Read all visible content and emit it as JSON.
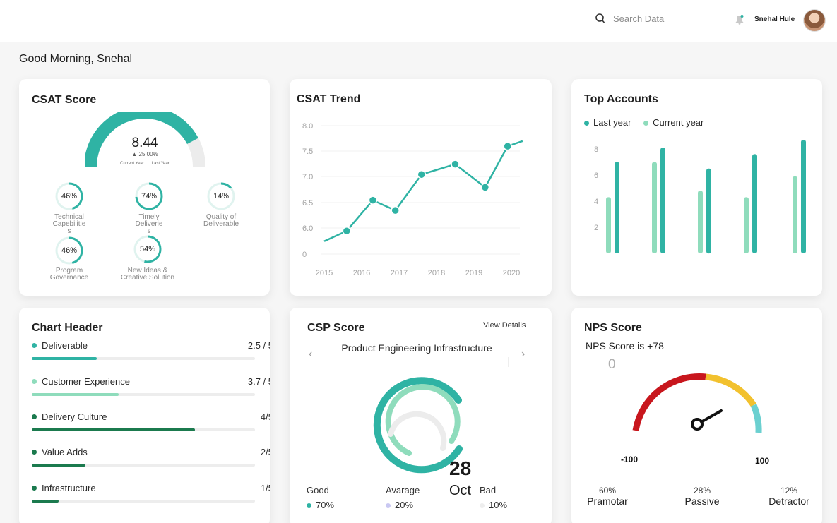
{
  "header": {
    "search_placeholder": "Search Data",
    "user_name": "Snehal Hule",
    "icons": {
      "search": "search-icon",
      "bell": "bell-icon",
      "avatar": "user-avatar"
    }
  },
  "greeting": "Good Morning, Snehal",
  "colors": {
    "teal": "#2fb3a4",
    "light_teal": "#8fdcbc",
    "dark_green": "#1b7a4e",
    "red": "#c8161d",
    "yellow": "#f2c12e",
    "cyan": "#6bd0d0"
  },
  "csat_score": {
    "title": "CSAT Score",
    "value": "8.44",
    "change": "▲ 25.00%",
    "gauge_fraction": 0.844,
    "legend_current": "Current Year",
    "legend_sep": "|",
    "legend_last": "Last Year",
    "rings": [
      {
        "value": "46%",
        "percent": 46,
        "label1": "Technical",
        "label2": "Capebilitie",
        "label3": "s"
      },
      {
        "value": "74%",
        "percent": 74,
        "label1": "Timely",
        "label2": "Deliverie",
        "label3": "s"
      },
      {
        "value": "14%",
        "percent": 14,
        "label1": "Quality of",
        "label2": "Deliverable",
        "label3": ""
      },
      {
        "value": "46%",
        "percent": 46,
        "label1": "Program",
        "label2": "Governance",
        "label3": ""
      },
      {
        "value": "54%",
        "percent": 54,
        "label1": "New Ideas &",
        "label2": "Creative Solution",
        "label3": ""
      }
    ]
  },
  "csat_trend": {
    "title": "CSAT Trend"
  },
  "top_accounts": {
    "title": "Top Accounts",
    "legend_last": "Last year",
    "legend_current": "Current year"
  },
  "chart_header": {
    "title": "Chart Header",
    "items": [
      {
        "label": "Deliverable",
        "score": "2.5 / 5",
        "fraction": 0.29,
        "color": "#2fb3a4"
      },
      {
        "label": "Customer Experience",
        "score": "3.7 / 5",
        "fraction": 0.39,
        "color": "#8fdcbc"
      },
      {
        "label": "Delivery Culture",
        "score": "4/5",
        "fraction": 0.73,
        "color": "#1b7a4e"
      },
      {
        "label": "Value Adds",
        "score": "2/5",
        "fraction": 0.24,
        "color": "#1b7a4e"
      },
      {
        "label": "Infrastructure",
        "score": "1/5",
        "fraction": 0.12,
        "color": "#1b7a4e"
      }
    ]
  },
  "csp_score": {
    "title": "CSP Score",
    "view_details": "View Details",
    "subject": "Product Engineering Infrastructure",
    "day": "28",
    "month": "Oct",
    "stats": [
      {
        "label": "Good",
        "value": "70%",
        "color": "#2fb3a4"
      },
      {
        "label": "Avarage",
        "value": "20%",
        "color": "#c9c8f2"
      },
      {
        "label": "Bad",
        "value": "10%",
        "color": "#eeeeee"
      }
    ]
  },
  "nps_score": {
    "title": "NPS Score",
    "subtitle": "NPS Score is +78",
    "zero_label": "0",
    "min_label": "-100",
    "max_label": "100",
    "value": 78,
    "stats": [
      {
        "percent": "60%",
        "label": "Pramotar"
      },
      {
        "percent": "28%",
        "label": "Passive"
      },
      {
        "percent": "12%",
        "label": "Detractor"
      }
    ]
  },
  "chart_data": [
    {
      "type": "line",
      "title": "CSAT Trend",
      "x": [
        2015,
        2015.6,
        2016.3,
        2016.9,
        2017.6,
        2018.5,
        2019.3,
        2019.9,
        2020.3
      ],
      "y": [
        5.75,
        5.95,
        6.55,
        6.35,
        7.05,
        7.25,
        6.8,
        7.6,
        7.7
      ],
      "marked_points": [
        1,
        2,
        3,
        4,
        5,
        6,
        7
      ],
      "x_ticks": [
        "2015",
        "2016",
        "2017",
        "2018",
        "2019",
        "2020"
      ],
      "y_ticks": [
        "0",
        "6.0",
        "6.5",
        "7.0",
        "7.5",
        "8.0"
      ],
      "ylim": [
        5.5,
        8.0
      ],
      "grid": true
    },
    {
      "type": "bar",
      "title": "Top Accounts",
      "categories": [
        "1",
        "2",
        "3",
        "4",
        "5"
      ],
      "series": [
        {
          "name": "Last year",
          "color": "#8fdcbc",
          "values": [
            4.3,
            7.0,
            4.8,
            4.3,
            5.9
          ]
        },
        {
          "name": "Current year",
          "color": "#2fb3a4",
          "values": [
            7.0,
            8.1,
            6.5,
            7.6,
            8.7
          ]
        }
      ],
      "y_ticks": [
        "2",
        "4",
        "6",
        "8"
      ],
      "ylim": [
        0,
        9
      ],
      "legend": "top-left"
    }
  ]
}
